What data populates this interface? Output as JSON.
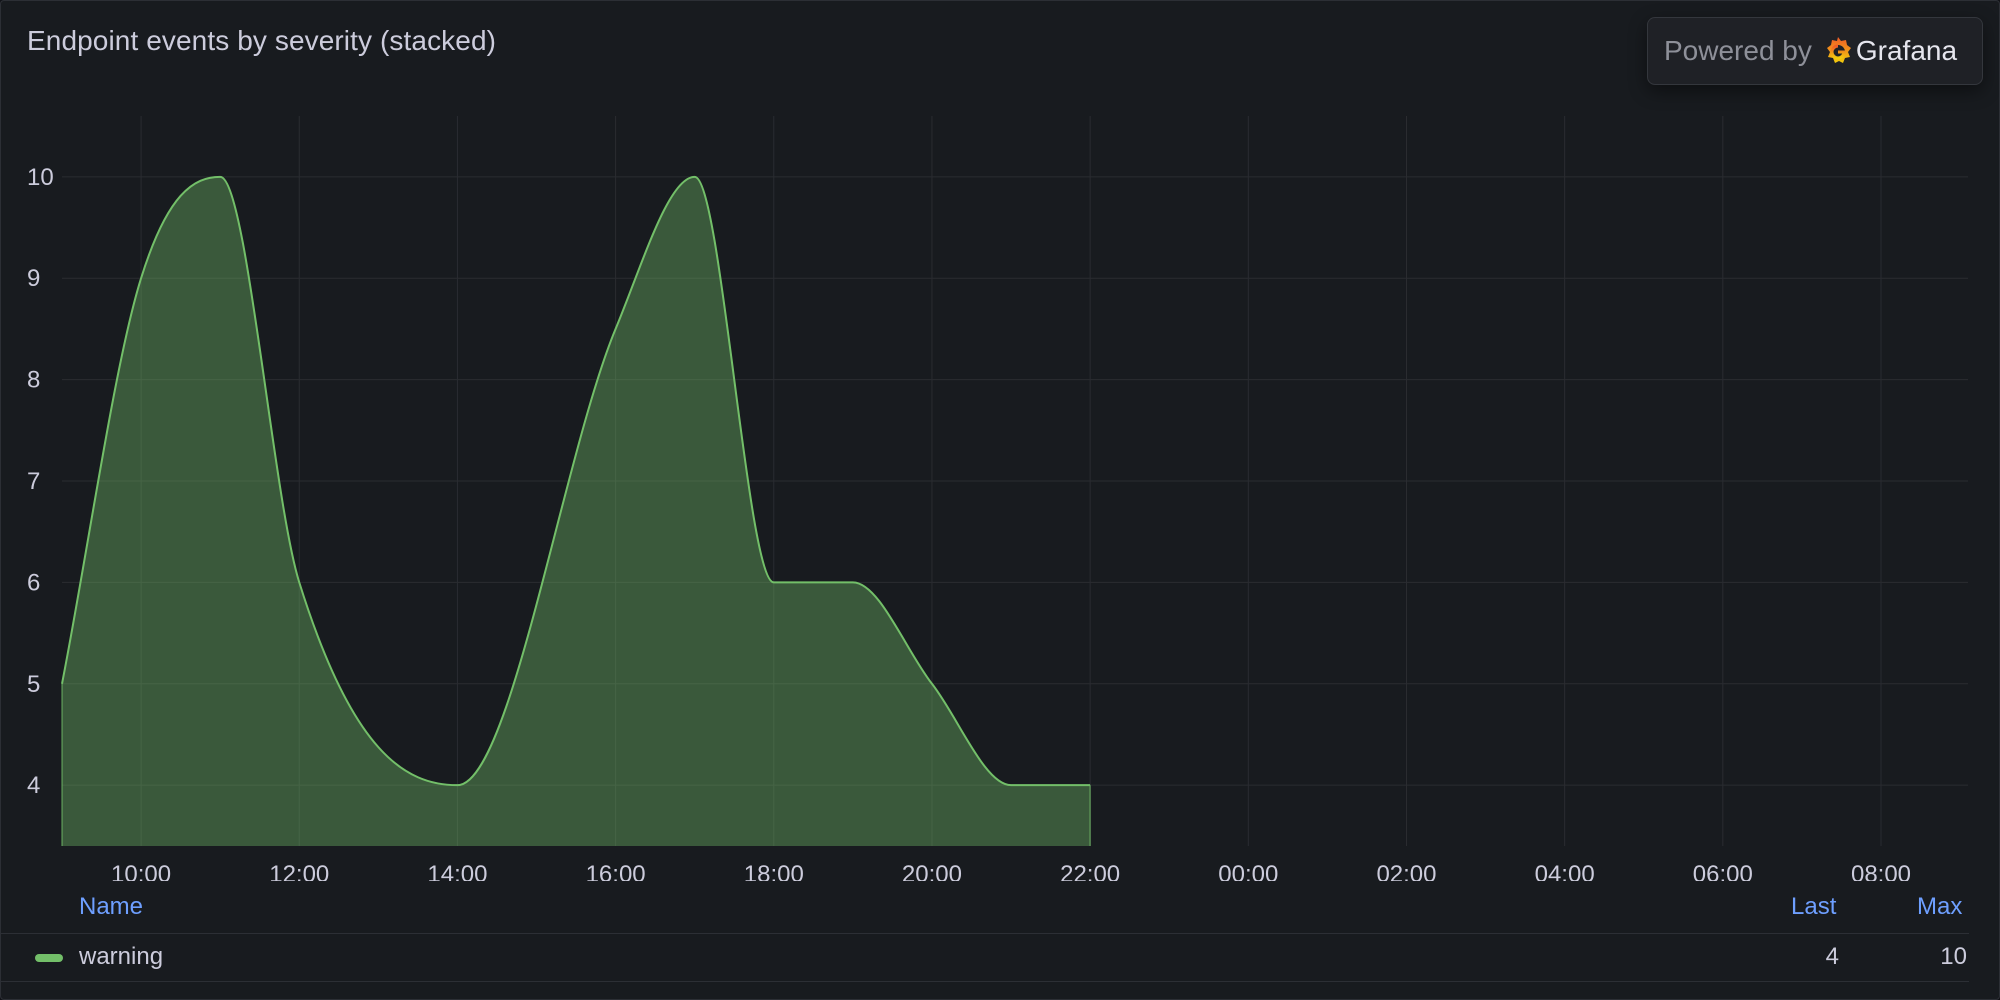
{
  "panel": {
    "title": "Endpoint events by severity (stacked)"
  },
  "branding": {
    "powered_by": "Powered by",
    "brand": "Grafana",
    "logo_icon": "grafana-logo-icon"
  },
  "colors": {
    "series": "#73bf69",
    "legend_header": "#6e9fff",
    "grid": "#2a2c31"
  },
  "legend": {
    "columns": {
      "name": "Name",
      "last": "Last",
      "max": "Max"
    },
    "rows": [
      {
        "name": "warning",
        "last": "4",
        "max": "10"
      }
    ]
  },
  "chart_data": {
    "type": "area",
    "title": "Endpoint events by severity (stacked)",
    "xlabel": "",
    "ylabel": "",
    "x_ticks": [
      "10:00",
      "12:00",
      "14:00",
      "16:00",
      "18:00",
      "20:00",
      "22:00",
      "00:00",
      "02:00",
      "04:00",
      "06:00",
      "08:00"
    ],
    "y_ticks": [
      4,
      5,
      6,
      7,
      8,
      9,
      10
    ],
    "ylim": [
      3.4,
      10.6
    ],
    "x_range_hours": [
      9,
      33.1
    ],
    "grid": true,
    "legend_position": "bottom",
    "series": [
      {
        "name": "warning",
        "color": "#73bf69",
        "x_hours": [
          9,
          10,
          11,
          12,
          14,
          16,
          17,
          18,
          19,
          20,
          21,
          22
        ],
        "x": [
          "09:00",
          "10:00",
          "11:00",
          "12:00",
          "14:00",
          "16:00",
          "17:00",
          "18:00",
          "19:00",
          "20:00",
          "21:00",
          "22:00"
        ],
        "values": [
          5,
          9,
          10,
          6,
          4,
          8.5,
          10,
          6,
          6,
          5,
          4,
          4
        ]
      }
    ]
  }
}
